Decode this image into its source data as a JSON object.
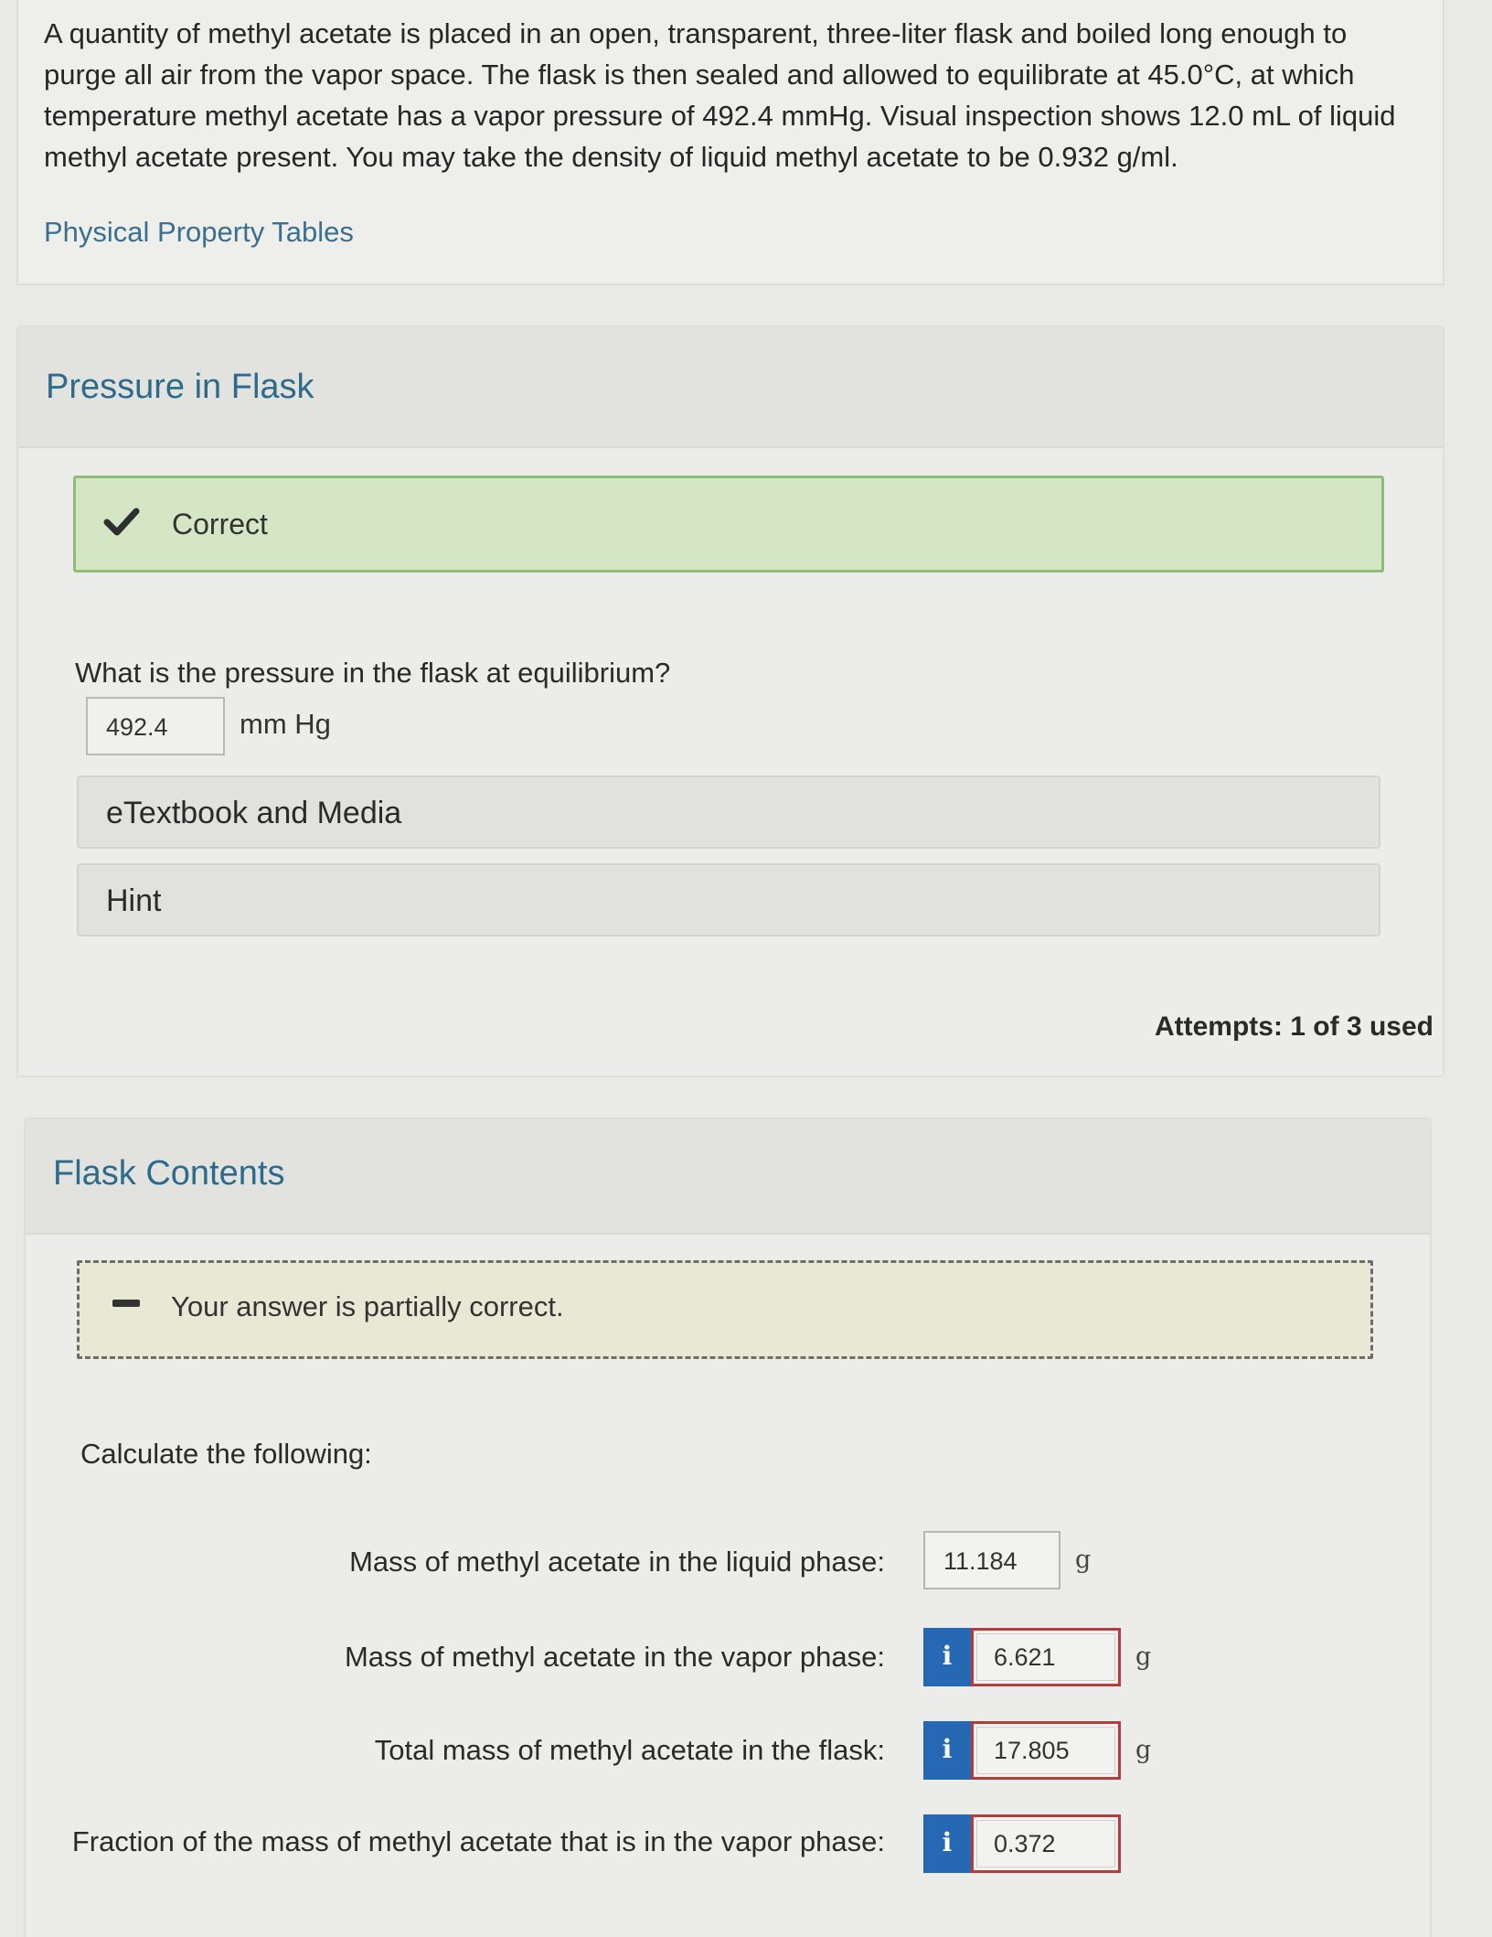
{
  "question": {
    "text": "A quantity of methyl acetate is placed in an open, transparent, three-liter flask and boiled long enough to purge all air from the vapor space. The flask is then sealed and allowed to equilibrate at 45.0°C, at which temperature methyl acetate has a vapor pressure of 492.4 mmHg. Visual inspection shows 12.0 mL of liquid methyl acetate present. You may take the density of liquid methyl acetate to be 0.932 g/ml.",
    "link": "Physical Property Tables"
  },
  "pressure_section": {
    "title": "Pressure in Flask",
    "status": "Correct",
    "prompt": "What is the pressure in the flask at equilibrium?",
    "answer": "492.4",
    "unit": "mm Hg",
    "etextbook": "eTextbook and Media",
    "hint": "Hint",
    "attempts": "Attempts: 1 of 3 used"
  },
  "flask_section": {
    "title": "Flask Contents",
    "status": "Your answer is partially correct.",
    "calc_label": "Calculate the following:",
    "rows": [
      {
        "label": "Mass of methyl acetate in the liquid phase:",
        "value": "11.184",
        "unit": "g"
      },
      {
        "label": "Mass of methyl acetate in the vapor phase:",
        "value": "6.621",
        "unit": "g"
      },
      {
        "label": "Total mass of methyl acetate in the flask:",
        "value": "17.805",
        "unit": "g"
      },
      {
        "label": "Fraction of the mass of methyl acetate that is in the vapor phase:",
        "value": "0.372",
        "unit": ""
      }
    ],
    "info_glyph": "i"
  },
  "colors": {
    "correct_bg": "#d4e6c4",
    "correct_border": "#8fbd78",
    "section_title": "#2d6b8c",
    "info_button": "#2668b4",
    "incorrect_border": "#b33c3c"
  }
}
